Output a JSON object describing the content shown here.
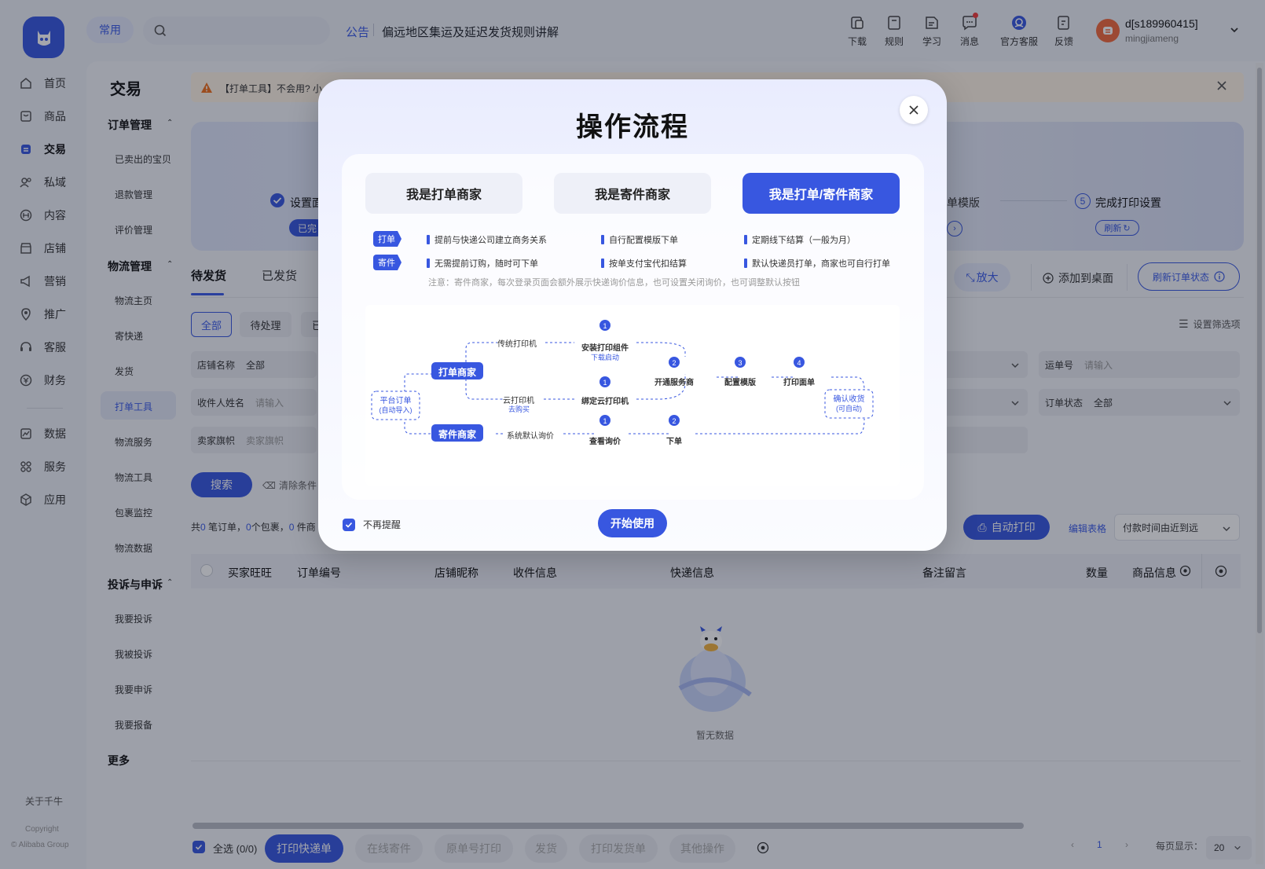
{
  "topbar": {
    "common_label": "常用",
    "notice_label": "公告",
    "notice_text": "偏远地区集运及延迟发货规则讲解",
    "tools": [
      {
        "label": "下载",
        "icon": "download-icon"
      },
      {
        "label": "规则",
        "icon": "rules-icon"
      },
      {
        "label": "学习",
        "icon": "learn-icon"
      },
      {
        "label": "消息",
        "icon": "message-icon"
      },
      {
        "label": "官方客服",
        "icon": "support-icon"
      },
      {
        "label": "反馈",
        "icon": "feedback-icon"
      }
    ],
    "user_name": "d[s189960415]",
    "user_sub": "mingjiameng"
  },
  "nav": {
    "items": [
      {
        "label": "首页",
        "icon": "home-icon"
      },
      {
        "label": "商品",
        "icon": "goods-icon"
      },
      {
        "label": "交易",
        "icon": "trade-icon"
      },
      {
        "label": "私域",
        "icon": "private-icon"
      },
      {
        "label": "内容",
        "icon": "content-icon"
      },
      {
        "label": "店铺",
        "icon": "store-icon"
      },
      {
        "label": "营销",
        "icon": "marketing-icon"
      },
      {
        "label": "推广",
        "icon": "promote-icon"
      },
      {
        "label": "客服",
        "icon": "service-icon"
      },
      {
        "label": "财务",
        "icon": "finance-icon"
      },
      {
        "label": "数据",
        "icon": "data-icon"
      },
      {
        "label": "服务",
        "icon": "services-icon"
      },
      {
        "label": "应用",
        "icon": "apps-icon"
      }
    ],
    "about": "关于千牛",
    "copyright1": "Copyright",
    "copyright2": "© Alibaba Group"
  },
  "subnav": {
    "title": "交易",
    "groups": [
      {
        "label": "订单管理",
        "items": [
          "已卖出的宝贝",
          "退款管理",
          "评价管理"
        ]
      },
      {
        "label": "物流管理",
        "items": [
          "物流主页",
          "寄快递",
          "发货",
          "打单工具",
          "物流服务",
          "物流工具",
          "包裹监控",
          "物流数据"
        ]
      },
      {
        "label": "投诉与申诉",
        "items": [
          "我要投诉",
          "我被投诉",
          "我要申诉",
          "我要报备"
        ]
      }
    ],
    "more": "更多"
  },
  "main": {
    "alert_text": "【打单工具】不会用? 小",
    "banner": {
      "step_left": "设置面",
      "step_left_badge": "已完",
      "step_mid": "单模版",
      "step_right_num": "5",
      "step_right": "完成打印设置",
      "refresh": "刷新"
    },
    "tabs": [
      "待发货",
      "已发货"
    ],
    "actions": {
      "zoom": "放大",
      "add_desktop": "添加到桌面",
      "refresh_status": "刷新订单状态"
    },
    "filter_chips": [
      "全部",
      "待处理",
      "已"
    ],
    "filter_settings": "设置筛选项",
    "fields": {
      "store_name": {
        "label": "店铺名称",
        "value": "全部"
      },
      "receiver": {
        "label": "收件人姓名",
        "placeholder": "请输入"
      },
      "flag": {
        "label": "卖家旗帜",
        "placeholder": "卖家旗帜"
      },
      "waybill": {
        "label": "运单号",
        "placeholder": "请输入"
      },
      "order_status": {
        "label": "订单状态",
        "value": "全部"
      }
    },
    "search_label": "搜索",
    "clear_label": "清除条件",
    "stats": {
      "p1": "共",
      "orders": "0",
      "p2": " 笔订单，",
      "packages": "0",
      "p3": "个包裹，",
      "items": "0",
      "p4": " 件商"
    },
    "auto_print": "自动打印",
    "edit_table": "编辑表格",
    "sort_value": "付款时间由近到远",
    "columns": [
      "买家旺旺",
      "订单编号",
      "店铺昵称",
      "收件信息",
      "快递信息",
      "备注留言",
      "数量",
      "商品信息"
    ],
    "empty_text": "暂无数据"
  },
  "bottom": {
    "select_all": "全选 (0/0)",
    "buttons": [
      "打印快递单",
      "在线寄件",
      "原单号打印",
      "发货",
      "打印发货单",
      "其他操作"
    ],
    "page": "1",
    "per_page_label": "每页显示：",
    "per_page": "20"
  },
  "modal": {
    "title": "操作流程",
    "tabs": [
      "我是打单商家",
      "我是寄件商家",
      "我是打单/寄件商家"
    ],
    "rows": [
      {
        "tag": "打单",
        "items": [
          "提前与快递公司建立商务关系",
          "自行配置模版下单",
          "定期线下结算（一般为月）"
        ]
      },
      {
        "tag": "寄件",
        "items": [
          "无需提前订购，随时可下单",
          "按单支付宝代扣结算",
          "默认快递员打单，商家也可自行打单"
        ]
      }
    ],
    "note": "注意：寄件商家，每次登录页面会额外展示快递询价信息，也可设置关闭询价，也可调整默认按钮",
    "diagram": {
      "platform1": "平台订单",
      "platform2": "(自动导入)",
      "print_merchant": "打单商家",
      "send_merchant": "寄件商家",
      "traditional": "传统打印机",
      "cloud": "云打印机",
      "buy": "去购买",
      "install": "安装打印组件",
      "download": "下载启动",
      "bind": "绑定云打印机",
      "open": "开通服务商",
      "config": "配置模版",
      "print": "打印面单",
      "default_quote": "系统默认询价",
      "view_quote": "查看询价",
      "order": "下单",
      "confirm1": "确认收货",
      "confirm2": "(可自动)",
      "n1": "1",
      "n2": "2",
      "n3": "3",
      "n4": "4"
    },
    "dont_remind": "不再提醒",
    "start": "开始使用"
  },
  "colors": {
    "accent": "#3857e0",
    "warning": "#f0701c"
  }
}
